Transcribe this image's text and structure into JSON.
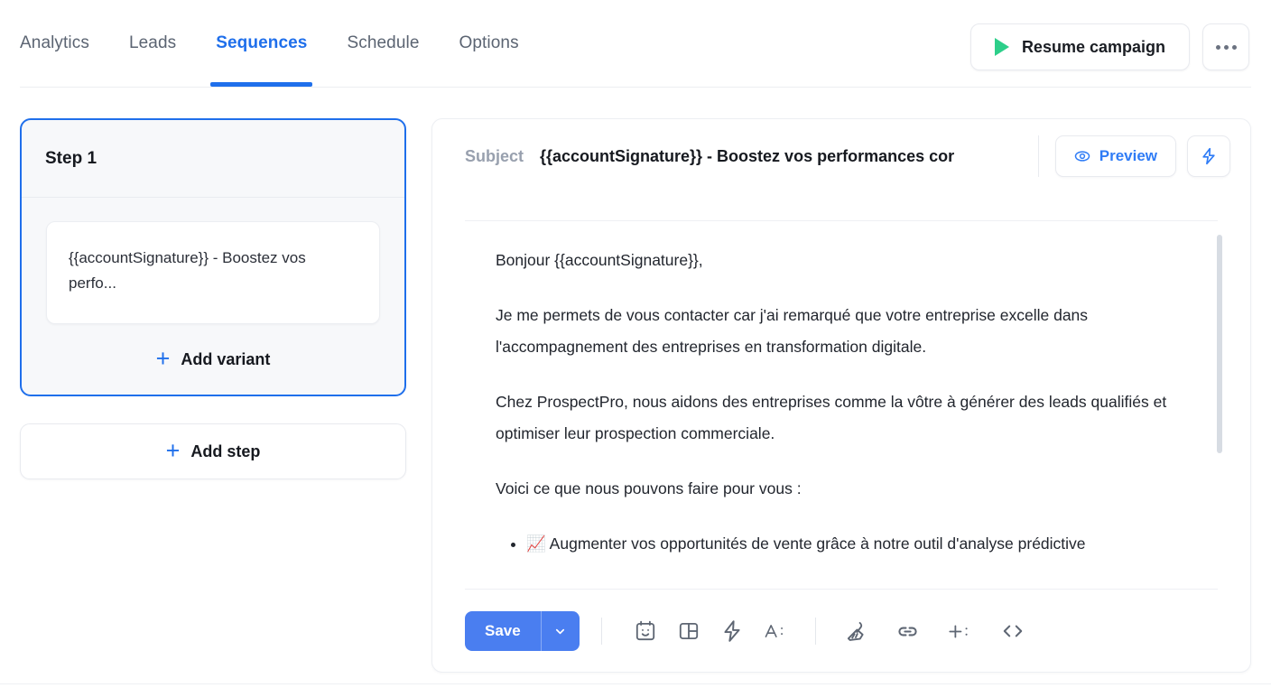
{
  "header": {
    "tabs": [
      {
        "label": "Analytics",
        "active": false
      },
      {
        "label": "Leads",
        "active": false
      },
      {
        "label": "Sequences",
        "active": true
      },
      {
        "label": "Schedule",
        "active": false
      },
      {
        "label": "Options",
        "active": false
      }
    ],
    "resume_button": {
      "label": "Resume campaign",
      "icon": "play-icon",
      "icon_color": "#2dcf8a"
    },
    "more_button": {
      "icon": "ellipsis-icon"
    }
  },
  "sequence_panel": {
    "step": {
      "title": "Step 1",
      "selected": true,
      "border_color": "#1f6feb",
      "variants": [
        {
          "text": "{{accountSignature}} - Boostez vos perfo..."
        }
      ],
      "add_variant_label": "Add variant"
    },
    "add_step_label": "Add step"
  },
  "editor": {
    "subject": {
      "label": "Subject",
      "value": "{{accountSignature}} - Boostez vos performances cor"
    },
    "preview_button": {
      "label": "Preview",
      "icon": "eye-icon"
    },
    "spark_button": {
      "icon": "lightning-icon"
    },
    "body": {
      "paragraphs": [
        "Bonjour {{accountSignature}},",
        "Je me permets de vous contacter car j'ai remarqué que votre entreprise excelle dans l'accompagnement des entreprises en transformation digitale.",
        "Chez ProspectPro, nous aidons des entreprises comme la vôtre à générer des leads qualifiés et optimiser leur prospection commerciale.",
        "Voici ce que nous pouvons faire pour vous :"
      ],
      "bullets": [
        "📈 Augmenter vos opportunités de vente grâce à notre outil d'analyse prédictive"
      ]
    },
    "toolbar": {
      "save_label": "Save",
      "save_caret_icon": "chevron-down-icon",
      "buttons": [
        {
          "icon": "emoji-calendar-icon"
        },
        {
          "icon": "layout-grid-icon"
        },
        {
          "icon": "lightning-icon"
        },
        {
          "icon": "text-format-icon",
          "label": "A:"
        },
        {
          "icon": "broom-clear-format-icon"
        },
        {
          "icon": "link-icon"
        },
        {
          "icon": "insert-variable-icon"
        },
        {
          "icon": "code-icon"
        }
      ]
    }
  },
  "colors": {
    "accent_blue": "#1f6feb",
    "save_blue": "#4a7ef0",
    "play_green": "#2dcf8a",
    "text_dark": "#16191f",
    "text_muted": "#5b6472"
  }
}
